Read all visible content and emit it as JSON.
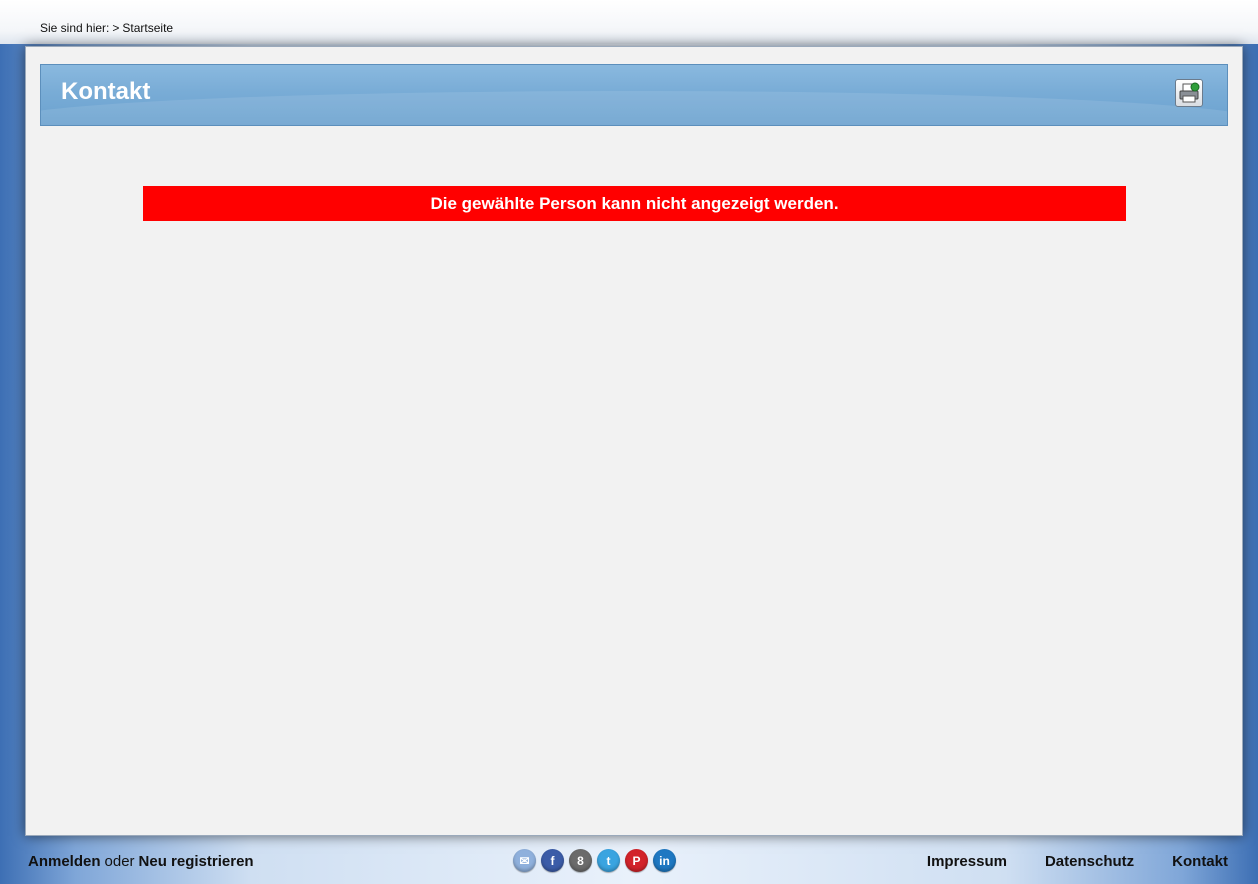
{
  "breadcrumb": {
    "prefix": "Sie sind hier:",
    "separator": ">",
    "current": "Startseite"
  },
  "header": {
    "title": "Kontakt",
    "print_icon": "printer-icon"
  },
  "message": {
    "text": "Die gewählte Person kann nicht angezeigt werden.",
    "color": "#ff0000"
  },
  "footer": {
    "login_label": "Anmelden",
    "or_label": "oder",
    "register_label": "Neu registrieren",
    "social": [
      {
        "name": "share-icon",
        "glyph": "✉",
        "color": "#8fb0dc"
      },
      {
        "name": "facebook-icon",
        "glyph": "f",
        "color": "#3b5ca8"
      },
      {
        "name": "google-plus-icon",
        "glyph": "8",
        "color": "#6b6b6b"
      },
      {
        "name": "twitter-icon",
        "glyph": "t",
        "color": "#3aa4e0"
      },
      {
        "name": "pinterest-icon",
        "glyph": "P",
        "color": "#d2232a"
      },
      {
        "name": "linkedin-icon",
        "glyph": "in",
        "color": "#1e78c2"
      }
    ],
    "links": {
      "impressum": "Impressum",
      "datenschutz": "Datenschutz",
      "kontakt": "Kontakt"
    }
  }
}
